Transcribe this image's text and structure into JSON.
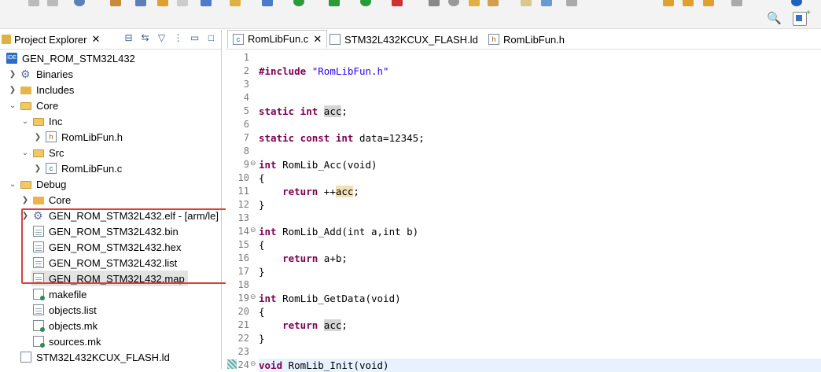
{
  "explorer": {
    "title": "Project Explorer",
    "close": "✕",
    "items": [
      {
        "label": "GEN_ROM_STM32L432"
      },
      {
        "label": "Binaries"
      },
      {
        "label": "Includes"
      },
      {
        "label": "Core"
      },
      {
        "label": "Inc"
      },
      {
        "label": "RomLibFun.h"
      },
      {
        "label": "Src"
      },
      {
        "label": "RomLibFun.c"
      },
      {
        "label": "Debug"
      },
      {
        "label": "Core"
      },
      {
        "label": "GEN_ROM_STM32L432.elf - [arm/le]"
      },
      {
        "label": "GEN_ROM_STM32L432.bin"
      },
      {
        "label": "GEN_ROM_STM32L432.hex"
      },
      {
        "label": "GEN_ROM_STM32L432.list"
      },
      {
        "label": "GEN_ROM_STM32L432.map"
      },
      {
        "label": "makefile"
      },
      {
        "label": "objects.list"
      },
      {
        "label": "objects.mk"
      },
      {
        "label": "sources.mk"
      },
      {
        "label": "STM32L432KCUX_FLASH.ld"
      }
    ]
  },
  "editor": {
    "tabs": [
      {
        "label": "RomLibFun.c",
        "close": "✕"
      },
      {
        "label": "STM32L432KCUX_FLASH.ld"
      },
      {
        "label": "RomLibFun.h"
      }
    ],
    "line_numbers": [
      "1",
      "2",
      "3",
      "4",
      "5",
      "6",
      "7",
      "8",
      "9",
      "10",
      "11",
      "12",
      "13",
      "14",
      "15",
      "16",
      "17",
      "18",
      "19",
      "20",
      "21",
      "22",
      "23",
      "24"
    ],
    "code": {
      "l2_kw": "#include",
      "l2_str": "\"RomLibFun.h\"",
      "l5_kw": "static int",
      "l5_var": "acc",
      "l5_end": ";",
      "l7_kw": "static const int",
      "l7_rest": " data=12345;",
      "l9_kw": "int",
      "l9_rest": " RomLib_Acc(void)",
      "l10": "{",
      "l11_kw": "return",
      "l11_pre": " ++",
      "l11_var": "acc",
      "l11_end": ";",
      "l12": "}",
      "l14_kw": "int",
      "l14_rest": " RomLib_Add(int a,int b)",
      "l15": "{",
      "l16_kw": "return",
      "l16_rest": " a+b;",
      "l17": "}",
      "l19_kw": "int",
      "l19_rest": " RomLib_GetData(void)",
      "l20": "{",
      "l21_kw": "return",
      "l21_sp": " ",
      "l21_var": "acc",
      "l21_end": ";",
      "l22": "}",
      "l24_kw": "void",
      "l24_rest": " RomLib_Init(void)"
    }
  },
  "toolbar": {
    "search_icon": "🔍"
  }
}
